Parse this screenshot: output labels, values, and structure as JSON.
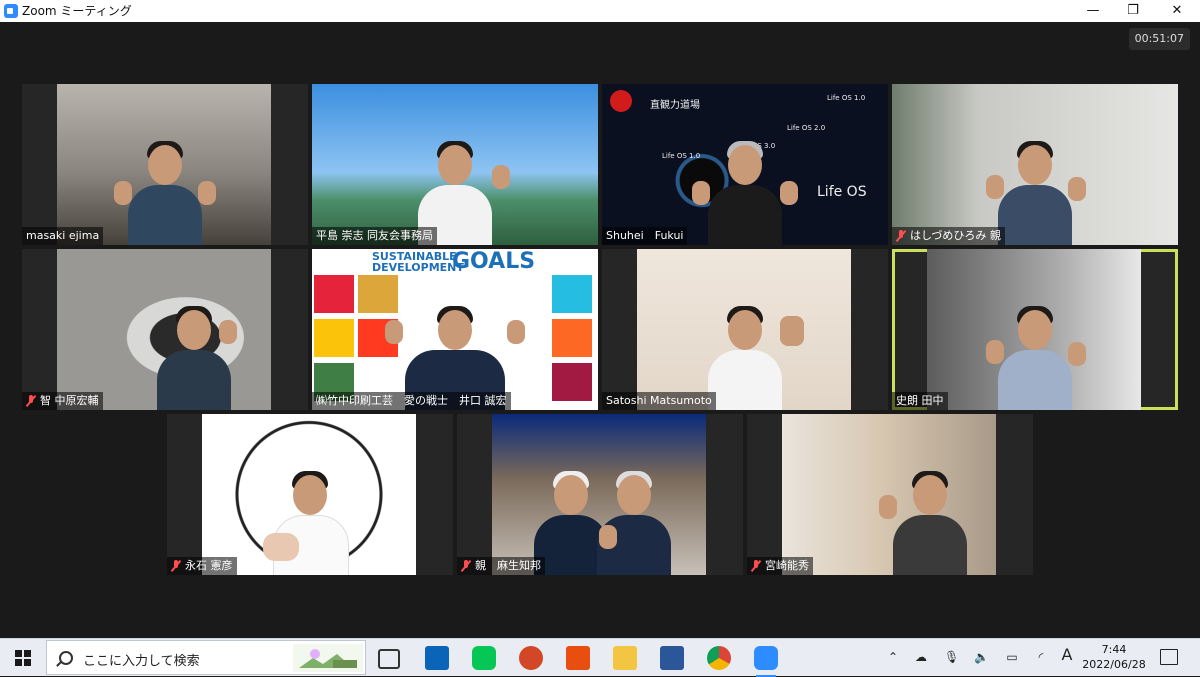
{
  "window": {
    "title": "Zoom ミーティング",
    "minimize_glyph": "—",
    "restore_glyph": "❐",
    "close_glyph": "✕"
  },
  "meeting": {
    "timer": "00:51:07",
    "participants": [
      {
        "name": "masaki ejima",
        "muted": false
      },
      {
        "name": "平島 崇志 同友会事務局",
        "muted": false
      },
      {
        "name": "Shuhei　Fukui",
        "muted": false
      },
      {
        "name": "はしづめひろみ 親",
        "muted": true
      },
      {
        "name": "智 中原宏輔",
        "muted": true
      },
      {
        "name": "㈱竹中印刷工芸　愛の戦士　井口 誠宏",
        "muted": false
      },
      {
        "name": "Satoshi Matsumoto",
        "muted": false
      },
      {
        "name": "史朗 田中",
        "muted": false,
        "speaking": true
      },
      {
        "name": "永石 憲彦",
        "muted": true
      },
      {
        "name": "親　麻生知邦",
        "muted": true
      },
      {
        "name": "宮崎能秀",
        "muted": true
      }
    ],
    "background_text": {
      "dojo_title": "直観力道場",
      "lifeos_1": "Life OS 1.0",
      "lifeos_2": "Life OS 2.0",
      "lifeos_3": "Life OS 3.0",
      "lifeos_brand": "Life OS",
      "sdg_line": "SUSTAINABLE\nDEVELOPMENT",
      "sdg_goals": "GOALS"
    }
  },
  "taskbar": {
    "search_placeholder": "ここに入力して検索",
    "ime_mode": "A",
    "time": "7:44",
    "date": "2022/06/28",
    "apps": [
      "task-view",
      "outlook",
      "line",
      "powerpoint",
      "office",
      "explorer",
      "word",
      "chrome",
      "zoom"
    ]
  },
  "colors": {
    "zoom_blue": "#2d8cff",
    "speaker_highlight": "#c8e05a",
    "mute_red": "#ff4d4f"
  }
}
